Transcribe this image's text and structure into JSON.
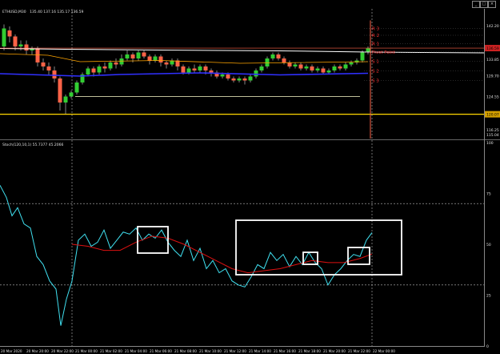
{
  "window": {
    "symbol_title": "ETHUSD,M30",
    "ohlc": "135.40  137.16  135.17  136.59",
    "buttons": [
      "_",
      "□",
      "×"
    ]
  },
  "price_panel": {
    "price_scale": [
      "142.20",
      "136.59",
      "133.85",
      "129.70",
      "124.55",
      "120.07",
      "116.25",
      "115.04"
    ],
    "current_price": 136.59,
    "current_price_label": "136.59",
    "support_price": 120.07,
    "support_price_label": "120.07",
    "pivot_labels": [
      "R 3",
      "R 2",
      "R 1",
      "Pivot Point",
      "S 1",
      "S 2",
      "S 3"
    ],
    "colors": {
      "bull": "#32cd32",
      "bear": "#ff6347",
      "support_line": "#ffd700",
      "ma_fast": "#ffffff",
      "ma_mid": "#ffa500",
      "ma_slow": "#3030ff",
      "pivot": "#ff3030"
    }
  },
  "stoch_panel": {
    "indicator_label": "Stoch(120,10,1) 55.7377 45.2066",
    "scale": [
      "100",
      "75",
      "50",
      "25",
      "0"
    ],
    "levels": [
      70,
      30
    ],
    "main_value": 55.7377,
    "signal_value": 45.2066,
    "colors": {
      "main": "#40e0f0",
      "signal": "#dd1111",
      "highlight": "#ffffff"
    }
  },
  "time_axis": [
    "20 Mar 2020",
    "20 Mar 20:00",
    "20 Mar 22:00",
    "21 Mar 00:00",
    "21 Mar 02:00",
    "21 Mar 04:00",
    "21 Mar 06:00",
    "21 Mar 08:00",
    "21 Mar 10:00",
    "21 Mar 12:00",
    "21 Mar 14:00",
    "21 Mar 16:00",
    "21 Mar 18:00",
    "21 Mar 20:00",
    "21 Mar 22:00",
    "22 Mar 00:00"
  ]
}
